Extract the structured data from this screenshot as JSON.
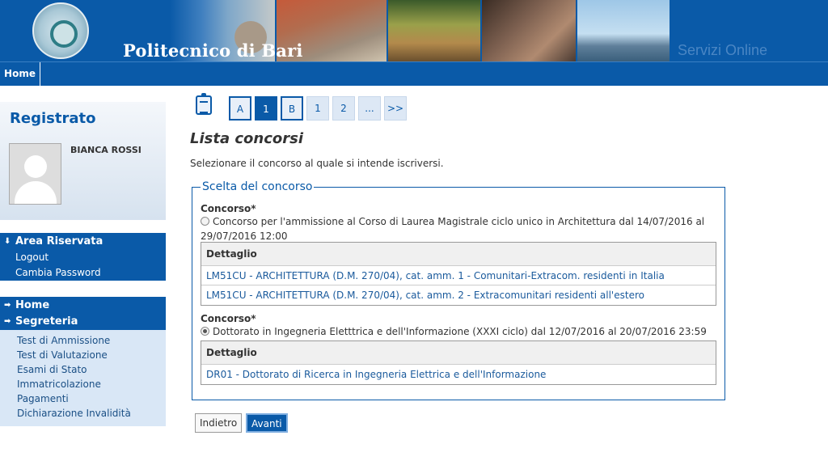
{
  "header": {
    "brand": "Politecnico di Bari",
    "services": "Servizi Online"
  },
  "nav": {
    "home": "Home"
  },
  "sidebar": {
    "title": "Registrato",
    "user_name": "BIANCA ROSSI",
    "area": {
      "title": "Area Riservata",
      "items": [
        "Logout",
        "Cambia Password"
      ]
    },
    "main_menu": {
      "home": "Home",
      "segreteria": "Segreteria"
    },
    "segreteria_items": [
      "Test di Ammissione",
      "Test di Valutazione",
      "Esami di Stato",
      "Immatricolazione",
      "Pagamenti",
      "Dichiarazione Invalidità"
    ]
  },
  "steps": [
    "A",
    "1",
    "B",
    "1",
    "2",
    "...",
    ">>"
  ],
  "main": {
    "title": "Lista concorsi",
    "intro": "Selezionare il concorso al quale si intende iscriversi.",
    "fieldset_legend": "Scelta del concorso",
    "concorsi": [
      {
        "label": "Concorso*",
        "text": "Concorso per l'ammissione al Corso di Laurea Magistrale ciclo unico in Architettura dal 14/07/2016 al 29/07/2016 12:00",
        "selected": false,
        "table_header": "Dettaglio",
        "details": [
          "LM51CU - ARCHITETTURA (D.M. 270/04), cat. amm. 1 - Comunitari-Extracom. residenti in Italia",
          "LM51CU - ARCHITETTURA (D.M. 270/04), cat. amm. 2 - Extracomunitari residenti all'estero"
        ]
      },
      {
        "label": "Concorso*",
        "text": "Dottorato in Ingegneria Eletttrica e dell'Informazione (XXXI ciclo) dal 12/07/2016 al 20/07/2016 23:59",
        "selected": true,
        "table_header": "Dettaglio",
        "details": [
          "DR01 - Dottorato di Ricerca in Ingegneria Elettrica e dell'Informazione"
        ]
      }
    ],
    "buttons": {
      "back": "Indietro",
      "next": "Avanti"
    }
  }
}
